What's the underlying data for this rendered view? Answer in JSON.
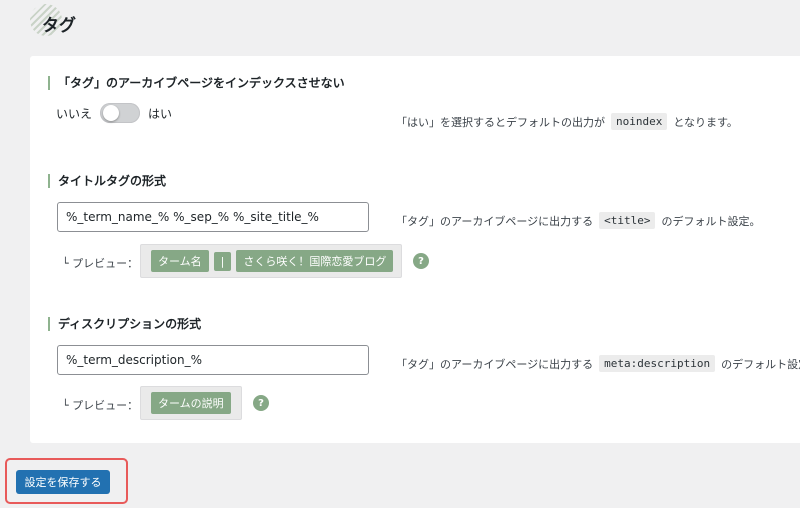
{
  "header": {
    "title": "タグ"
  },
  "noindex": {
    "heading": "「タグ」のアーカイブページをインデックスさせない",
    "option_off": "いいえ",
    "option_on": "はい",
    "toggle_on": false,
    "desc_prefix": "「はい」を選択するとデフォルトの出力が",
    "desc_code": "noindex",
    "desc_suffix": "となります。"
  },
  "title_format": {
    "heading": "タイトルタグの形式",
    "input_value": "%_term_name_% %_sep_% %_site_title_%",
    "desc_prefix": "「タグ」のアーカイブページに出力する",
    "desc_code": "<title>",
    "desc_suffix": "のデフォルト設定。",
    "preview_label": "└ プレビュー：",
    "preview_chips": [
      "ターム名",
      "|",
      "さくら咲く！国際恋愛ブログ"
    ]
  },
  "description_format": {
    "heading": "ディスクリプションの形式",
    "input_value": "%_term_description_%",
    "desc_prefix": "「タグ」のアーカイブページに出力する",
    "desc_code": "meta:description",
    "desc_suffix": "のデフォルト設定。",
    "preview_label": "└ プレビュー：",
    "preview_chips": [
      "タームの説明"
    ]
  },
  "help_glyph": "?",
  "footer": {
    "save_label": "設定を保存する"
  },
  "colors": {
    "accent": "#2271b1",
    "chip": "#86a886",
    "highlight": "#e85a5a"
  }
}
